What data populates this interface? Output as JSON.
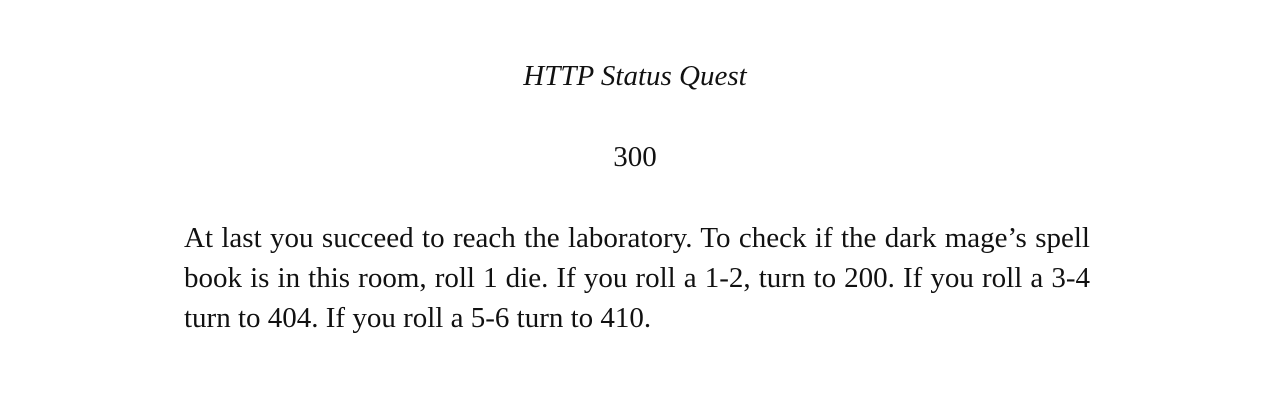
{
  "book": {
    "title": "HTTP Status Quest"
  },
  "section": {
    "number": "300",
    "text": "At last you succeed to reach the laboratory. To check if the dark mage’s spell book is in this room, roll 1 die. If you roll a 1-2, turn to 200. If you roll a 3-4 turn to 404. If you roll a 5-6 turn to 410."
  }
}
